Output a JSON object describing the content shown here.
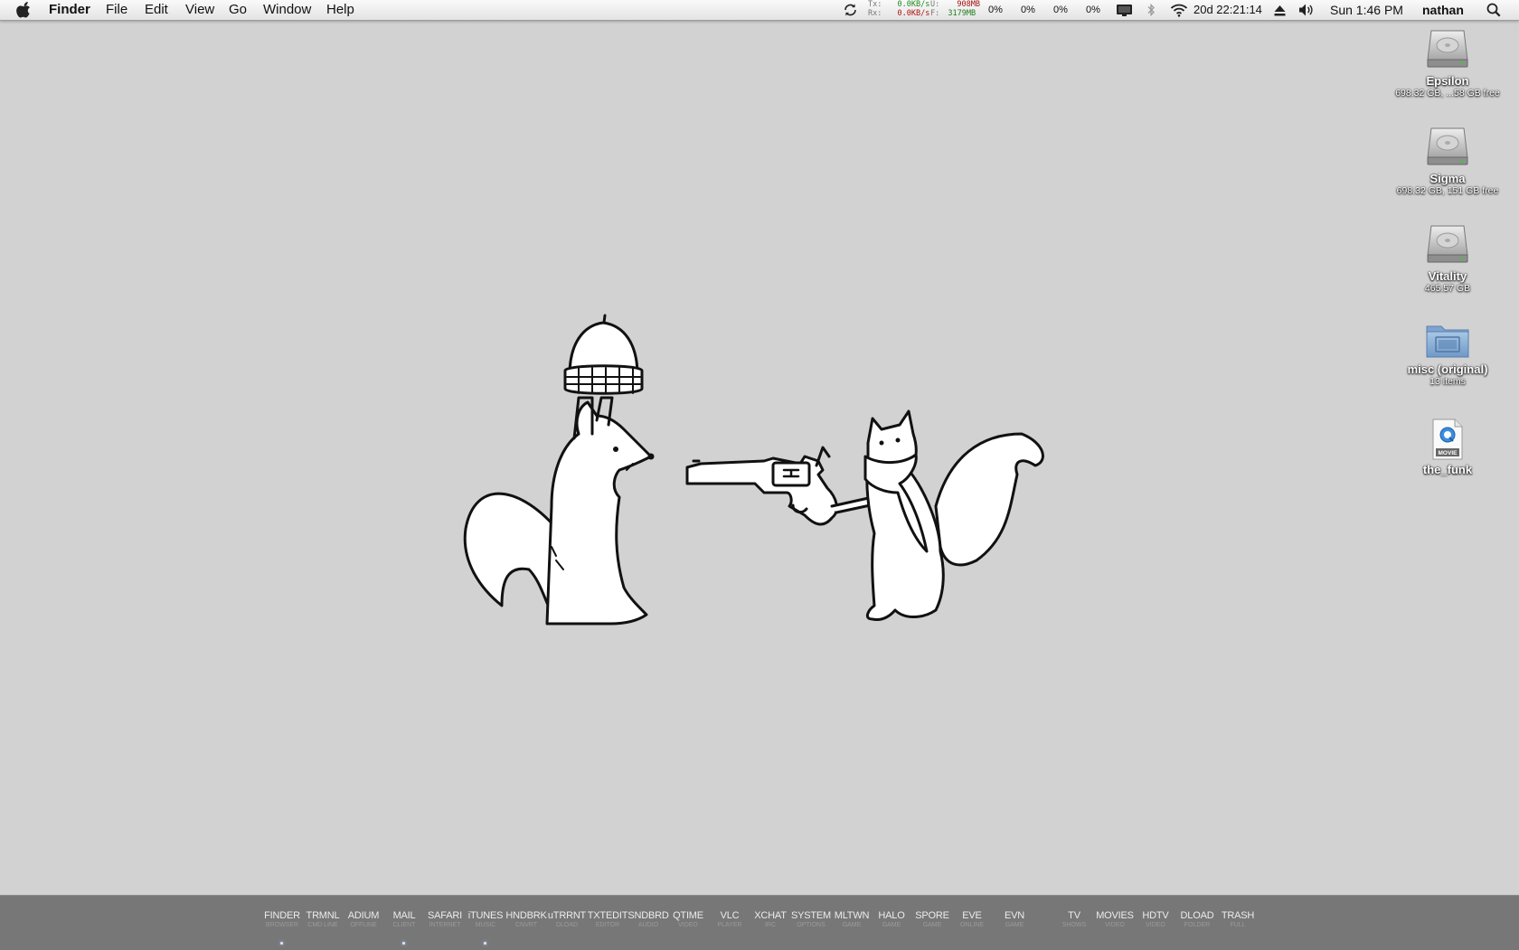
{
  "menubar": {
    "app_name": "Finder",
    "menus": [
      "File",
      "Edit",
      "View",
      "Go",
      "Window",
      "Help"
    ],
    "network": {
      "tx_label": "Tx:",
      "tx_value": "0.0KB/s",
      "rx_label": "Rx:",
      "rx_value": "0.0KB/s",
      "used_label": "U:",
      "used_value": "908MB",
      "free_label": "F:",
      "free_value": "3179MB"
    },
    "cpu": [
      "0%",
      "0%",
      "0%",
      "0%"
    ],
    "uptime": "20d 22:21:14",
    "clock": "Sun 1:46 PM",
    "user": "nathan",
    "icons": [
      "apple-icon",
      "sync-icon",
      "display-icon",
      "bluetooth-icon",
      "wifi-icon",
      "eject-icon",
      "volume-icon",
      "spotlight-icon"
    ]
  },
  "desktop": {
    "icons": [
      {
        "name": "Epsilon",
        "sub": "698.32 GB, ...58 GB free",
        "kind": "drive"
      },
      {
        "name": "Sigma",
        "sub": "698.32 GB, 151 GB free",
        "kind": "drive"
      },
      {
        "name": "Vitality",
        "sub": "465.57 GB",
        "kind": "drive"
      },
      {
        "name": "misc (original)",
        "sub": "13 items",
        "kind": "folder"
      },
      {
        "name": "the_funk",
        "sub": "",
        "kind": "movie"
      }
    ],
    "movie_badge": "MOVIE"
  },
  "dock": {
    "apps": [
      {
        "label": "FINDER",
        "sub": "BROWSER"
      },
      {
        "label": "TRMNL",
        "sub": "CMD LINE"
      },
      {
        "label": "ADIUM",
        "sub": "OFFLINE"
      },
      {
        "label": "MAIL",
        "sub": "CLIENT"
      },
      {
        "label": "SAFARI",
        "sub": "INTERNET"
      },
      {
        "label": "iTUNES",
        "sub": "MUSIC"
      },
      {
        "label": "HNDBRK",
        "sub": "CNVRT"
      },
      {
        "label": "uTRRNT",
        "sub": "DLOAD"
      },
      {
        "label": "TXTEDIT",
        "sub": "EDITOR"
      },
      {
        "label": "SNDBRD",
        "sub": "AUDIO"
      },
      {
        "label": "QTIME",
        "sub": "VIDEO"
      },
      {
        "label": "VLC",
        "sub": "PLAYER"
      },
      {
        "label": "XCHAT",
        "sub": "IRC"
      },
      {
        "label": "SYSTEM",
        "sub": "OPTIONS"
      },
      {
        "label": "MLTWN",
        "sub": "GAME"
      },
      {
        "label": "HALO",
        "sub": "GAME"
      },
      {
        "label": "SPORE",
        "sub": "GAME"
      },
      {
        "label": "EVE",
        "sub": "ONLINE"
      },
      {
        "label": "EVN",
        "sub": "GAME"
      },
      {
        "label": "TV",
        "sub": "SHOWS"
      },
      {
        "label": "MOVIES",
        "sub": "VIDEO"
      },
      {
        "label": "HDTV",
        "sub": "VIDEO"
      },
      {
        "label": "DLOAD",
        "sub": "FOLDER"
      },
      {
        "label": "TRASH",
        "sub": "FULL"
      }
    ],
    "running": [
      "FINDER",
      "MAIL",
      "iTUNES"
    ]
  }
}
